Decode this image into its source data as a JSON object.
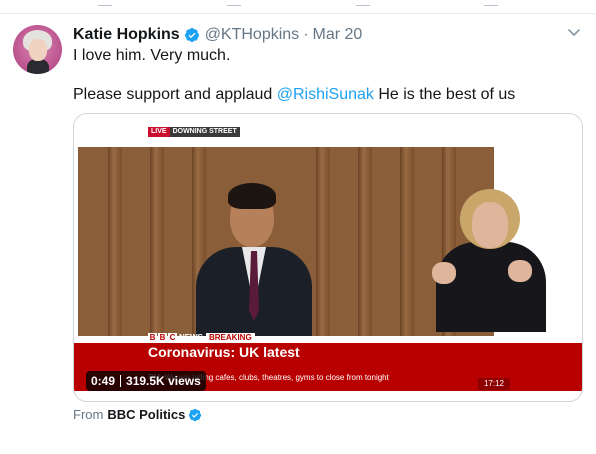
{
  "tweet": {
    "author_name": "Katie Hopkins",
    "handle": "@KTHopkins",
    "separator": "·",
    "date": "Mar 20",
    "line1": "I love him. Very much.",
    "line2_prefix": "Please support and applaud ",
    "line2_mention": "@RishiSunak",
    "line2_suffix": " He is the best of us"
  },
  "video": {
    "live_label": "LIVE",
    "location_label": "DOWNING STREET",
    "bbc_letters": [
      "B",
      "B",
      "C"
    ],
    "news_label": "NEWS",
    "breaking_label": "BREAKING",
    "headline": "Coronavirus: UK latest",
    "ticker": "PM: We are telling cafes, clubs, theatres, gyms to close from tonight",
    "clock": "17:12",
    "duration": "0:49",
    "views": "319.5K views"
  },
  "source": {
    "prefix": "From",
    "name": "BBC Politics"
  },
  "colors": {
    "accent": "#1da1f2",
    "text": "#14171a",
    "muted": "#657786",
    "bbc_red": "#b80000"
  },
  "icons": {
    "verified": "verified-badge-icon",
    "menu": "chevron-down-icon"
  }
}
